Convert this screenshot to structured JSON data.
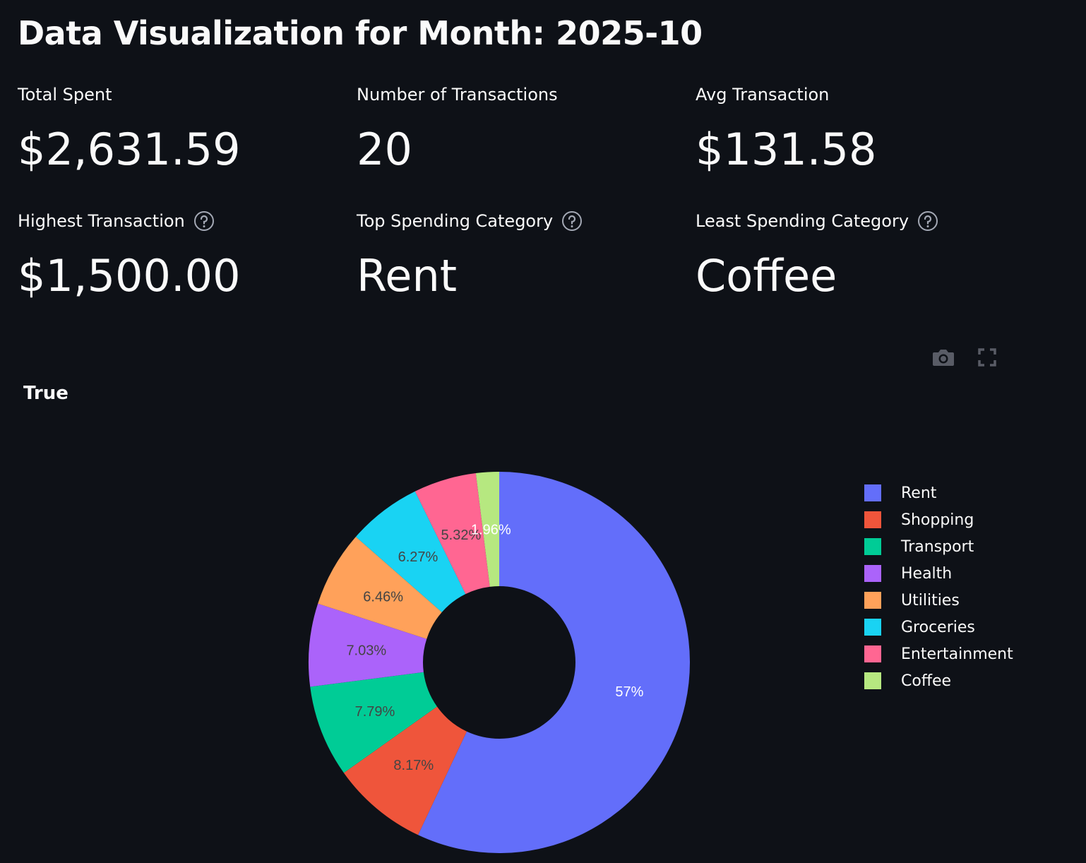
{
  "page": {
    "title": "Data Visualization for Month: 2025-10"
  },
  "metrics": [
    {
      "label": "Total Spent",
      "value": "$2,631.59",
      "help": false
    },
    {
      "label": "Number of Transactions",
      "value": "20",
      "help": false
    },
    {
      "label": "Avg Transaction",
      "value": "$131.58",
      "help": false
    },
    {
      "label": "Highest Transaction",
      "value": "$1,500.00",
      "help": true
    },
    {
      "label": "Top Spending Category",
      "value": "Rent",
      "help": true
    },
    {
      "label": "Least Spending Category",
      "value": "Coffee",
      "help": true
    }
  ],
  "toolbar": {
    "icons": [
      "camera-icon",
      "fullscreen-icon"
    ]
  },
  "chart_data": {
    "type": "pie",
    "hole": true,
    "title": "True",
    "legend_position": "right",
    "categories": [
      "Rent",
      "Shopping",
      "Transport",
      "Health",
      "Utilities",
      "Groceries",
      "Entertainment",
      "Coffee"
    ],
    "values": [
      57,
      8.17,
      7.79,
      7.03,
      6.46,
      6.27,
      5.32,
      1.96
    ],
    "labels": [
      "57%",
      "8.17%",
      "7.79%",
      "7.03%",
      "6.46%",
      "6.27%",
      "5.32%",
      "1.96%"
    ],
    "colors": [
      "#636efa",
      "#ef553b",
      "#00cc96",
      "#ab63fa",
      "#ffa15a",
      "#19d3f3",
      "#ff6692",
      "#b6e880"
    ]
  }
}
